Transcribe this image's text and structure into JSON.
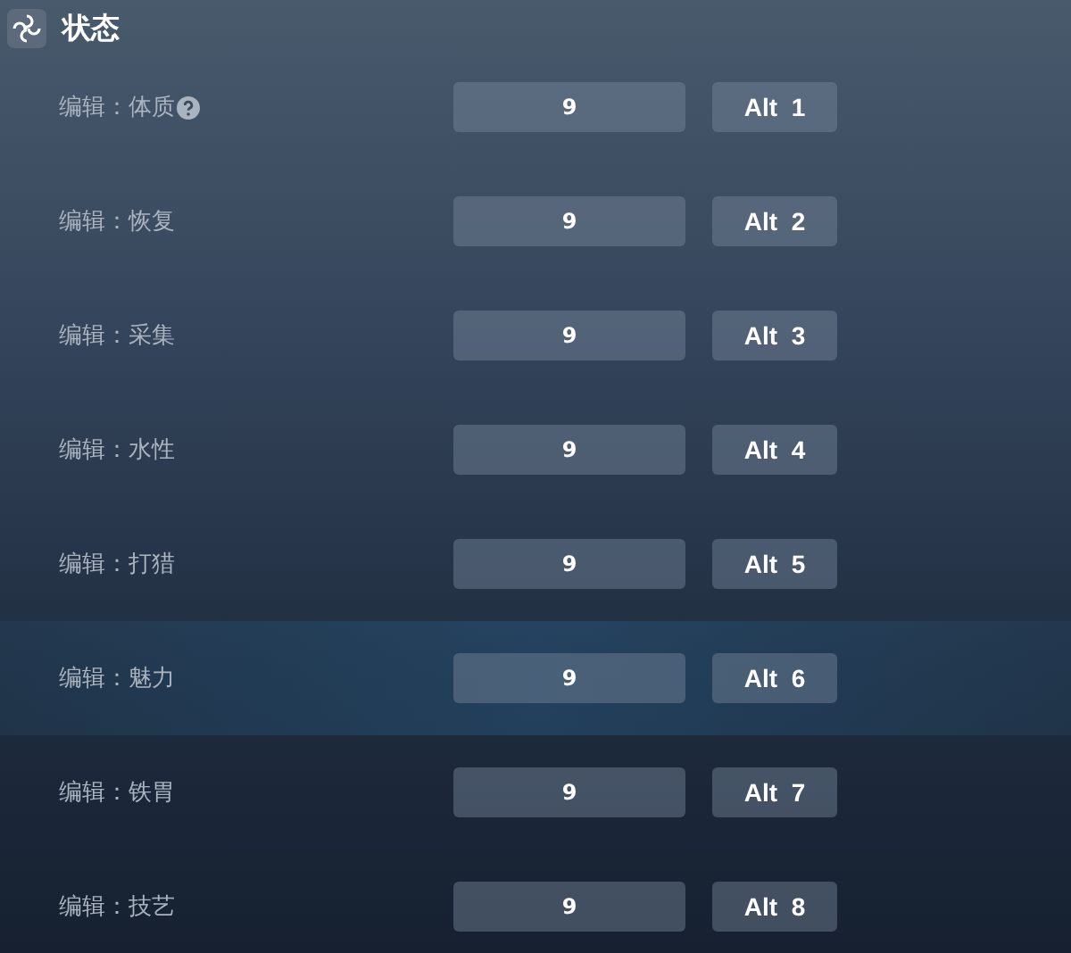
{
  "section": {
    "title": "状态"
  },
  "rows": [
    {
      "label": "编辑：体质",
      "help": true,
      "value": "9",
      "hotkey": "Alt  1",
      "selected": false
    },
    {
      "label": "编辑：恢复",
      "help": false,
      "value": "9",
      "hotkey": "Alt  2",
      "selected": false
    },
    {
      "label": "编辑：采集",
      "help": false,
      "value": "9",
      "hotkey": "Alt  3",
      "selected": false
    },
    {
      "label": "编辑：水性",
      "help": false,
      "value": "9",
      "hotkey": "Alt  4",
      "selected": false
    },
    {
      "label": "编辑：打猎",
      "help": false,
      "value": "9",
      "hotkey": "Alt  5",
      "selected": false
    },
    {
      "label": "编辑：魅力",
      "help": false,
      "value": "9",
      "hotkey": "Alt  6",
      "selected": true
    },
    {
      "label": "编辑：铁胃",
      "help": false,
      "value": "9",
      "hotkey": "Alt  7",
      "selected": false
    },
    {
      "label": "编辑：技艺",
      "help": false,
      "value": "9",
      "hotkey": "Alt  8",
      "selected": false
    }
  ]
}
